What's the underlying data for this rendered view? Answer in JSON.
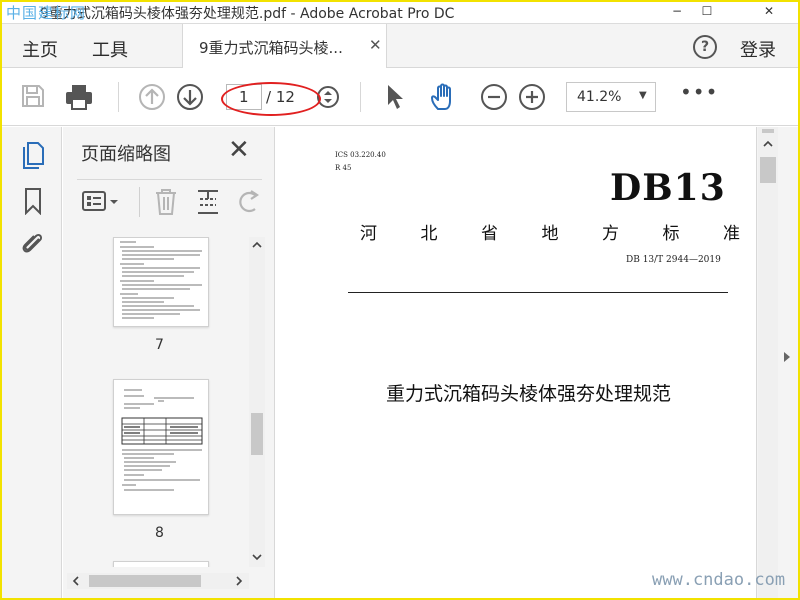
{
  "window": {
    "title": "9重力式沉箱码头棱体强夯处理规范.pdf - Adobe Acrobat Pro DC",
    "minimize_glyph": "−",
    "maximize_glyph": "☐",
    "close_glyph": "✕"
  },
  "watermark_top_left": "中国建标网",
  "nav": {
    "home": "主页",
    "tools": "工具",
    "login": "登录",
    "help_glyph": "?"
  },
  "tab": {
    "label": "9重力式沉箱码头棱...",
    "close_glyph": "✕"
  },
  "toolbar": {
    "page_current": "1",
    "page_total": "/ 12",
    "zoom": "41.2%",
    "zoom_arrow": "▼",
    "more": "•••"
  },
  "panel": {
    "title": "页面缩略图",
    "close_glyph": "✕",
    "thumbnails": [
      {
        "page": "7"
      },
      {
        "page": "8"
      }
    ]
  },
  "document": {
    "ics": "ICS 03.220.40",
    "r": "R 45",
    "code": "DB13",
    "province": [
      "河",
      "北",
      "省",
      "地",
      "方",
      "标",
      "准"
    ],
    "std_number": "DB 13/T 2944—2019",
    "title": "重力式沉箱码头棱体强夯处理规范"
  },
  "watermark_bottom_right": "www.cndao.com",
  "colors": {
    "frame": "#f2e200",
    "annotation": "#e12020",
    "accent_blue": "#2a6db8"
  }
}
